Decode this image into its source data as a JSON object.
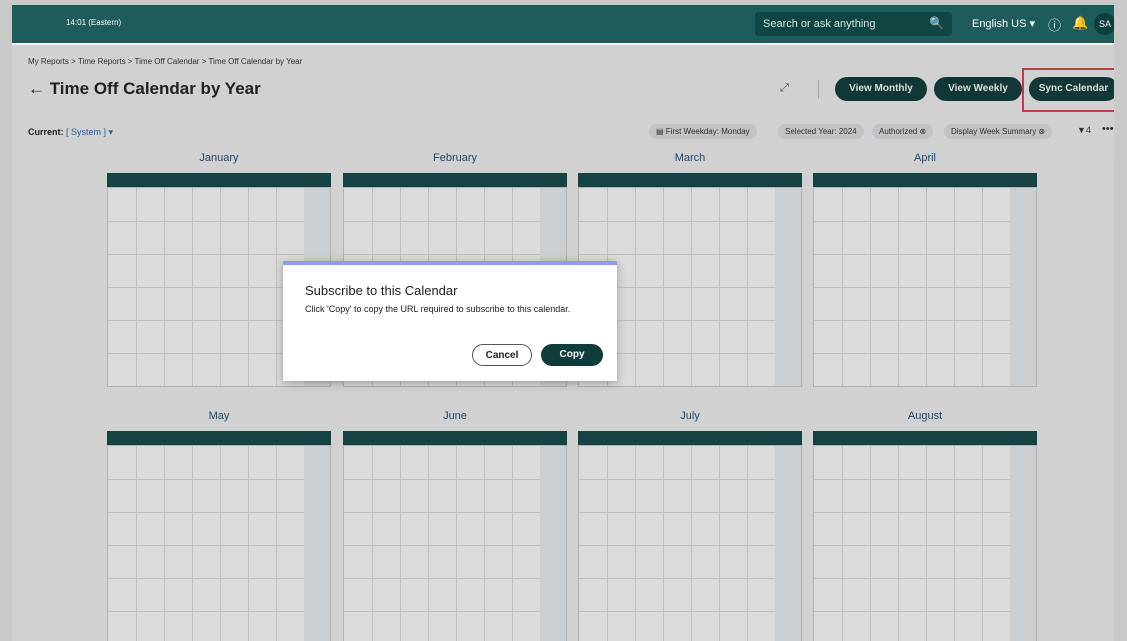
{
  "header": {
    "time": "14:01 (Eastern)",
    "search_placeholder": "Search or ask anything",
    "language": "English US ▾",
    "user_initials": "SA",
    "notification_count": "0"
  },
  "breadcrumb": "My Reports > Time Reports > Time Off Calendar > Time Off Calendar by Year",
  "page_title": "← Time Off Calendar by Year",
  "buttons": {
    "view_monthly": "View Monthly",
    "view_weekly": "View Weekly",
    "sync_calendar": "Sync Calendar"
  },
  "current": {
    "label": "Current:",
    "value": "[ System ] ▾"
  },
  "chips": {
    "first_weekday": "▤ First Weekday: Monday",
    "selected_year": "Selected Year: 2024",
    "authorized": "Authorized ⊗",
    "display_week_summary": "Display Week Summary ⊗"
  },
  "filter_count": "▼4",
  "months": [
    "January",
    "February",
    "March",
    "April",
    "May",
    "June",
    "July",
    "August"
  ],
  "dialog": {
    "title": "Subscribe to this Calendar",
    "message": "Click 'Copy' to copy the URL required to subscribe to this calendar.",
    "cancel": "Cancel",
    "copy": "Copy"
  },
  "colors": {
    "header_bg": "#1d5c5a",
    "primary_button": "#0f3d3b",
    "month_header": "#14494a",
    "event_pink": "#b24a78",
    "event_green": "#1f7a72",
    "event_purple": "#7c3b9b",
    "event_maroon": "#8b0f3a",
    "event_blue": "#6166d8"
  }
}
